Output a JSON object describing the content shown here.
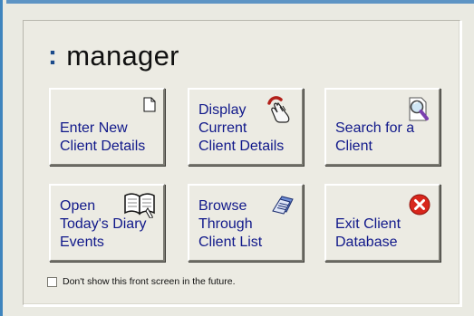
{
  "app": {
    "title": "manager",
    "title_prefix": ":"
  },
  "buttons": [
    {
      "label": "Enter New\nClient Details",
      "icon": "document-icon"
    },
    {
      "label": "Display\nCurrent\nClient Details",
      "icon": "hand-pointer-icon"
    },
    {
      "label": "Search for a\nClient",
      "icon": "magnifier-icon"
    },
    {
      "label": "Open\nToday's Diary\nEvents",
      "icon": "open-book-icon"
    },
    {
      "label": "Browse\nThrough\nClient List",
      "icon": "card-file-icon"
    },
    {
      "label": "Exit Client\nDatabase",
      "icon": "exit-icon"
    }
  ],
  "options": {
    "hide_front_screen_label": "Don't show this front screen in the future.",
    "hide_front_screen_checked": false
  },
  "colors": {
    "window_frame": "#3f85be",
    "label_text": "#10188a",
    "exit_icon": "#d8261c"
  }
}
